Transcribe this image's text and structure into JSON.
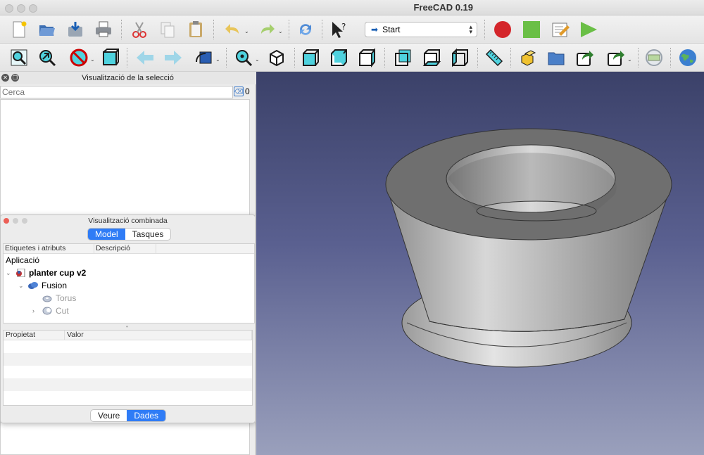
{
  "window": {
    "title": "FreeCAD 0.19"
  },
  "toolbar": {
    "workbench": "Start",
    "icons_row1": [
      "new-document-icon",
      "open-icon",
      "save-icon",
      "print-icon",
      "cut-icon",
      "copy-icon",
      "paste-icon",
      "undo-icon",
      "redo-icon",
      "refresh-icon",
      "whats-this-icon",
      "record-macro-icon",
      "stop-macro-icon",
      "edit-macro-icon",
      "run-macro-icon"
    ],
    "icons_row2": [
      "fit-all-icon",
      "fit-selection-icon",
      "draw-style-icon",
      "bounding-box-icon",
      "back-icon",
      "forward-icon",
      "sync-view-icon",
      "std-views-icon",
      "isometric-icon",
      "front-view-icon",
      "top-view-icon",
      "right-view-icon",
      "rear-view-icon",
      "bottom-view-icon",
      "left-view-icon",
      "measure-icon",
      "part-icon",
      "group-icon",
      "link-icon",
      "link-actions-icon",
      "global-placement-icon",
      "web-icon"
    ]
  },
  "selection_view": {
    "title": "Visualització de la selecció",
    "search_placeholder": "Cerca",
    "count": "0"
  },
  "combo_view": {
    "title": "Visualització combinada",
    "tabs": [
      "Model",
      "Tasques"
    ],
    "active_tab": "Model",
    "tree_headers": [
      "Etiquetes i atributs",
      "Descripció"
    ],
    "tree": {
      "root": "Aplicació",
      "document": "planter cup v2",
      "fusion": "Fusion",
      "torus": "Torus",
      "cut": "Cut"
    },
    "property_headers": [
      "Propietat",
      "Valor"
    ],
    "bottom_tabs": [
      "Veure",
      "Dades"
    ],
    "active_bottom_tab": "Dades"
  },
  "colors": {
    "accent": "#2f7cf6",
    "viewport_top": "#3b4169",
    "viewport_bottom": "#9aa0bc",
    "record": "#d4262b",
    "stop": "#6abf46"
  }
}
